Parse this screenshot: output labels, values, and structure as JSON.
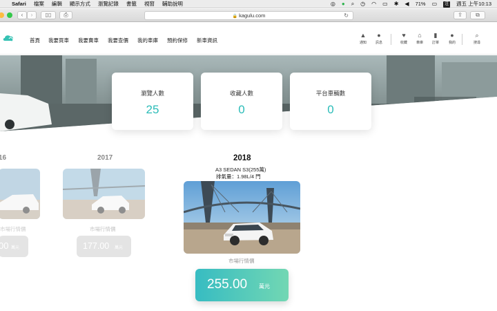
{
  "menubar": {
    "app": "Safari",
    "items": [
      "檔案",
      "編輯",
      "顯示方式",
      "瀏覽記錄",
      "書籤",
      "視窗",
      "輔助說明"
    ],
    "battery": "71%",
    "input_method": "注",
    "clock": "週五 上午10:13"
  },
  "browser": {
    "url": "kagulu.com"
  },
  "site_nav": {
    "links": [
      "首頁",
      "我要買車",
      "我要賣車",
      "我要查價",
      "我的車庫",
      "預約保修",
      "新車資訊"
    ],
    "icons": [
      {
        "label": "通知",
        "icon": "bell-icon"
      },
      {
        "label": "訊息",
        "icon": "chat-icon"
      },
      {
        "label": "收藏",
        "icon": "heart-icon"
      },
      {
        "label": "車庫",
        "icon": "garage-icon"
      },
      {
        "label": "訂單",
        "icon": "order-icon"
      },
      {
        "label": "我的",
        "icon": "user-icon"
      },
      {
        "label": "搜尋",
        "icon": "search-icon"
      }
    ]
  },
  "stats": [
    {
      "label": "瀏覽人數",
      "value": "25"
    },
    {
      "label": "收藏人數",
      "value": "0"
    },
    {
      "label": "平台車輛數",
      "value": "0"
    }
  ],
  "timeline": {
    "partial_year": "16",
    "partial_price": "00",
    "prev": {
      "year": "2017",
      "market_label": "市場行情價",
      "price": "177.00",
      "unit": "萬元"
    },
    "current": {
      "year": "2018",
      "model": "A3 SEDAN S3(255萬)",
      "displacement": "排氣量：1.98L/4 門",
      "market_label": "市場行情價",
      "price": "255.00",
      "unit": "萬元"
    },
    "partial_market_label": "市場行情價",
    "partial_unit": "萬元"
  },
  "colors": {
    "accent": "#2bbcb8",
    "price_gradient_start": "#37bcc2",
    "price_gradient_end": "#72d7b3"
  }
}
